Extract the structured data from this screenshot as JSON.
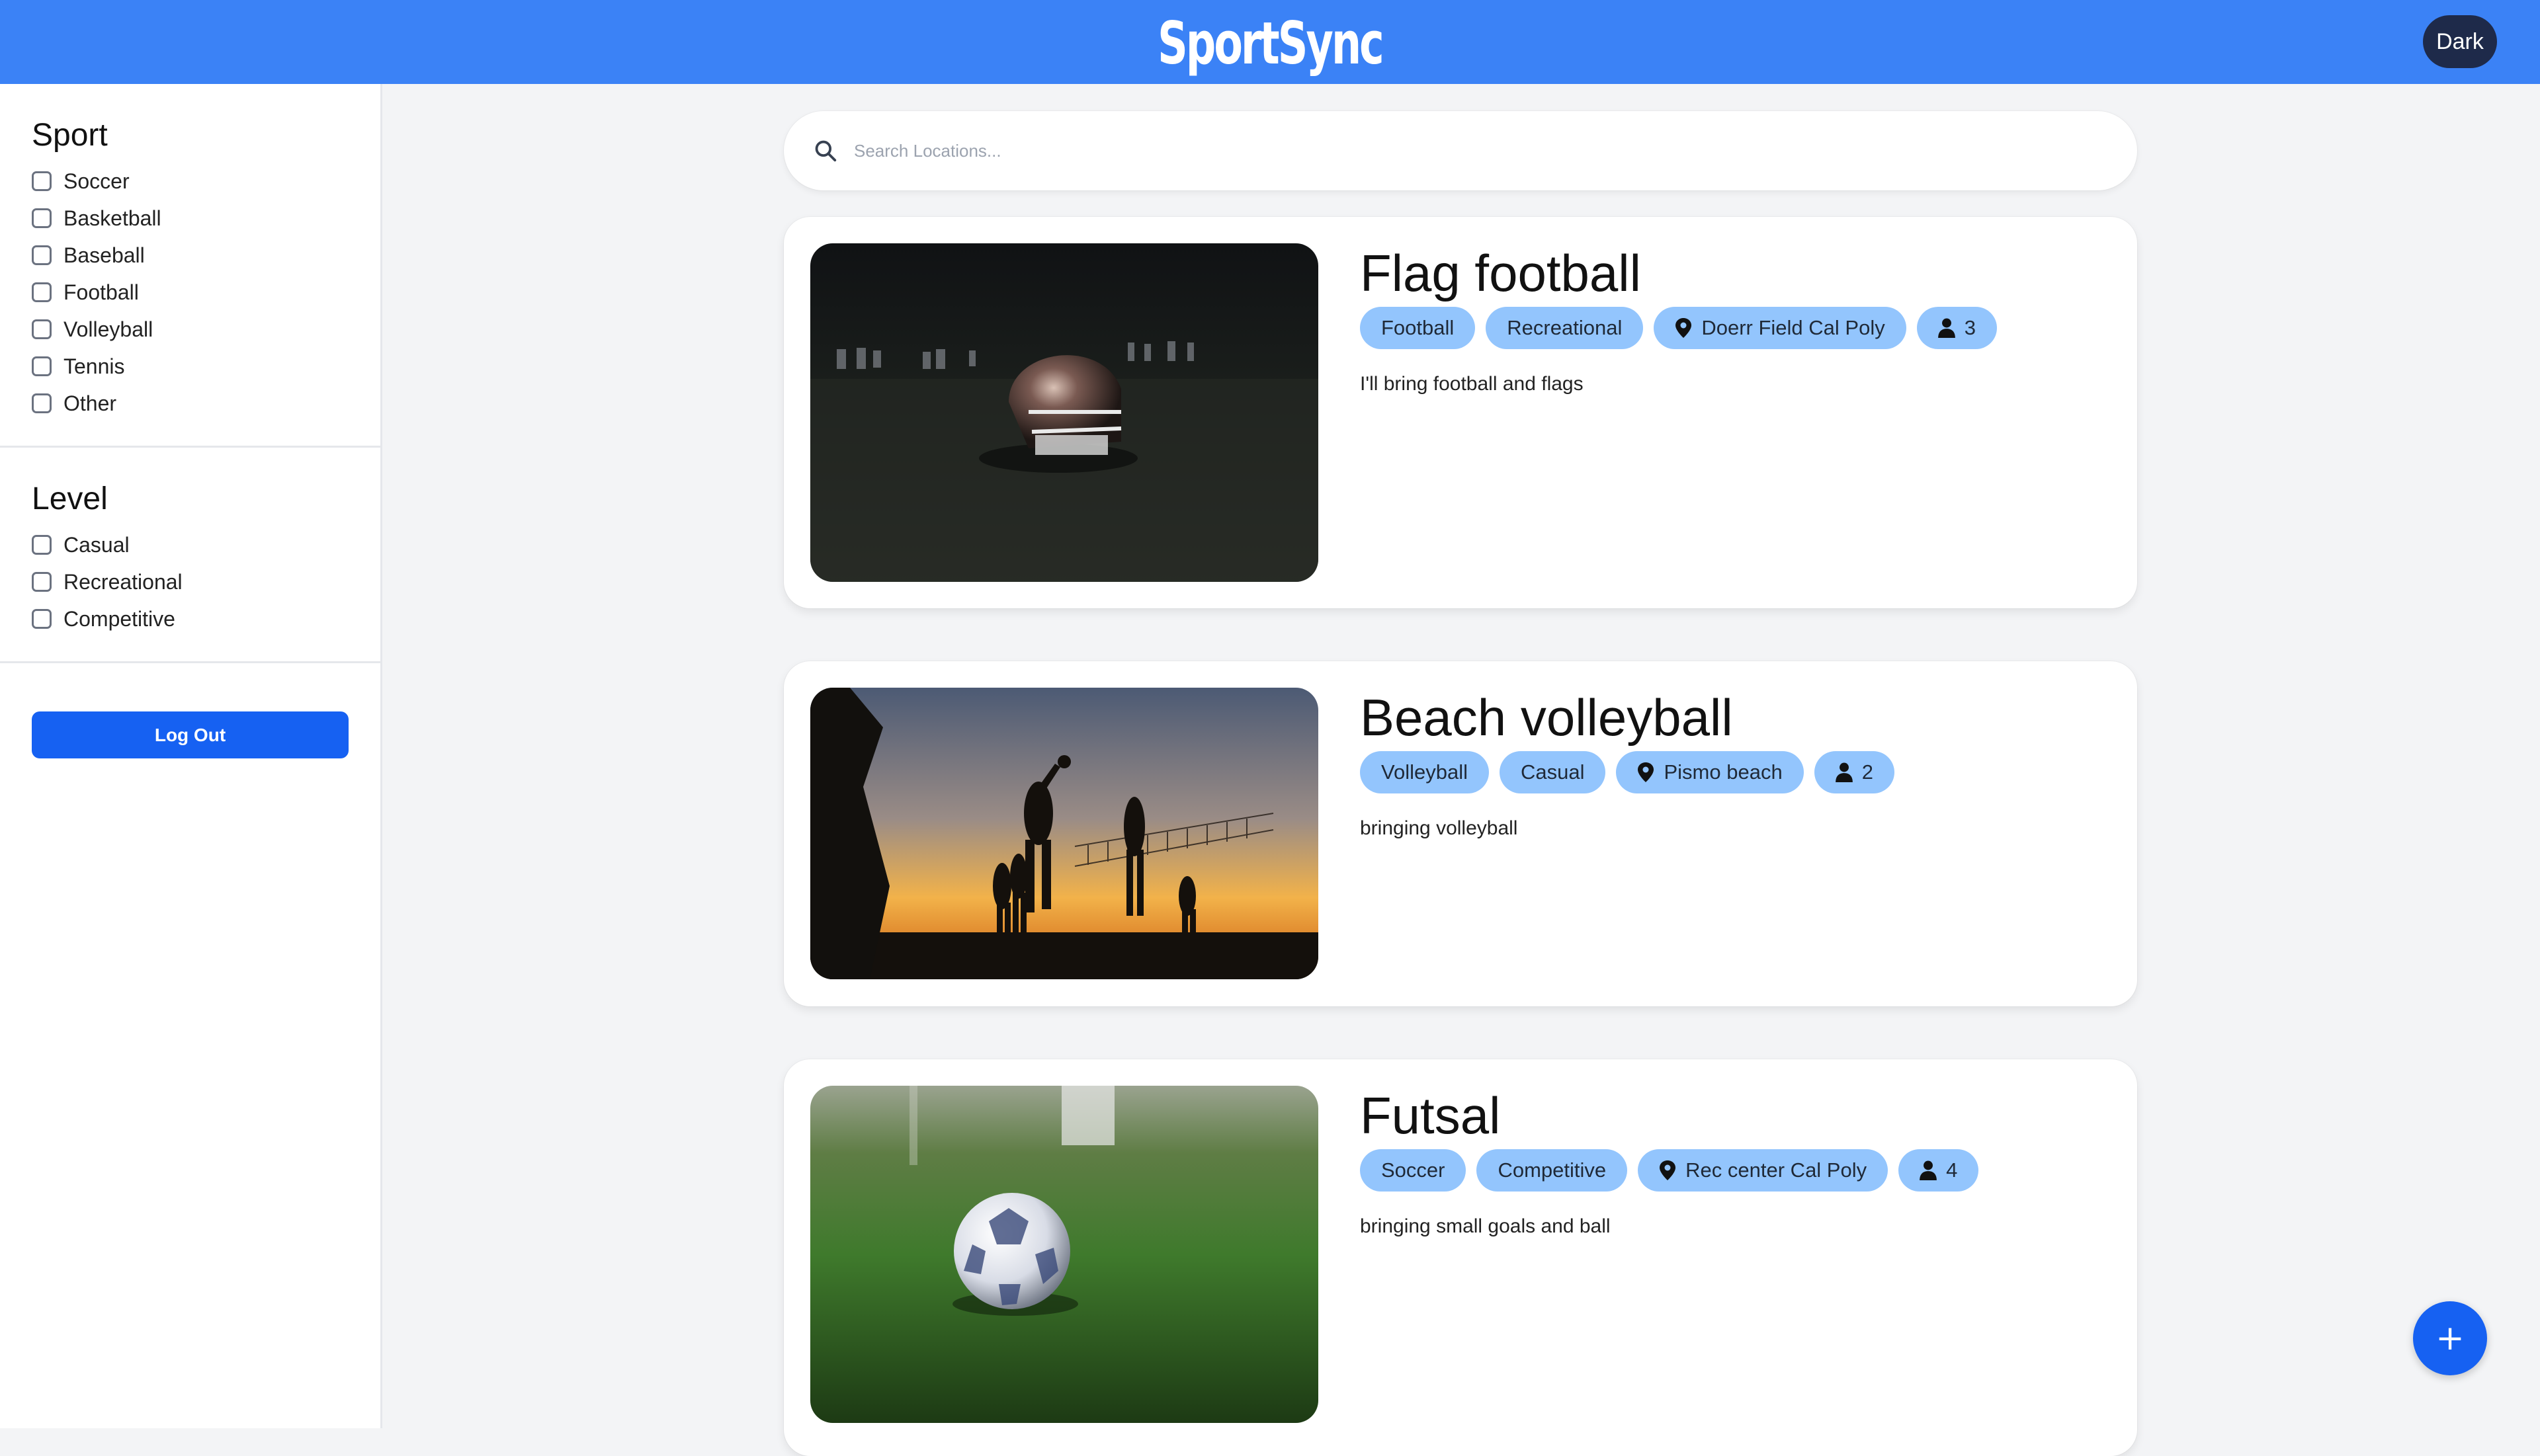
{
  "app": {
    "title": "SportSync",
    "theme_toggle_label": "Dark"
  },
  "sidebar": {
    "sport_title": "Sport",
    "sports": [
      "Soccer",
      "Basketball",
      "Baseball",
      "Football",
      "Volleyball",
      "Tennis",
      "Other"
    ],
    "level_title": "Level",
    "levels": [
      "Casual",
      "Recreational",
      "Competitive"
    ],
    "logout_label": "Log Out"
  },
  "search": {
    "placeholder": "Search Locations...",
    "value": "",
    "icon": "search-icon"
  },
  "posts": [
    {
      "title": "Flag football",
      "sport": "Football",
      "level": "Recreational",
      "location": "Doerr Field Cal Poly",
      "players": "3",
      "description": "I'll bring football and flags",
      "image": "football-helmet-photo"
    },
    {
      "title": "Beach volleyball",
      "sport": "Volleyball",
      "level": "Casual",
      "location": "Pismo beach",
      "players": "2",
      "description": "bringing volleyball",
      "image": "beach-volleyball-sunset-photo"
    },
    {
      "title": "Futsal",
      "sport": "Soccer",
      "level": "Competitive",
      "location": "Rec center Cal Poly",
      "players": "4",
      "description": "bringing small goals and ball",
      "image": "soccer-ball-on-turf-photo"
    }
  ],
  "fab": {
    "label": "+",
    "icon": "plus-icon"
  },
  "colors": {
    "header": "#3b82f6",
    "accent": "#1661f2",
    "tag": "#93c5fd",
    "theme_button": "#1e2a4a"
  }
}
